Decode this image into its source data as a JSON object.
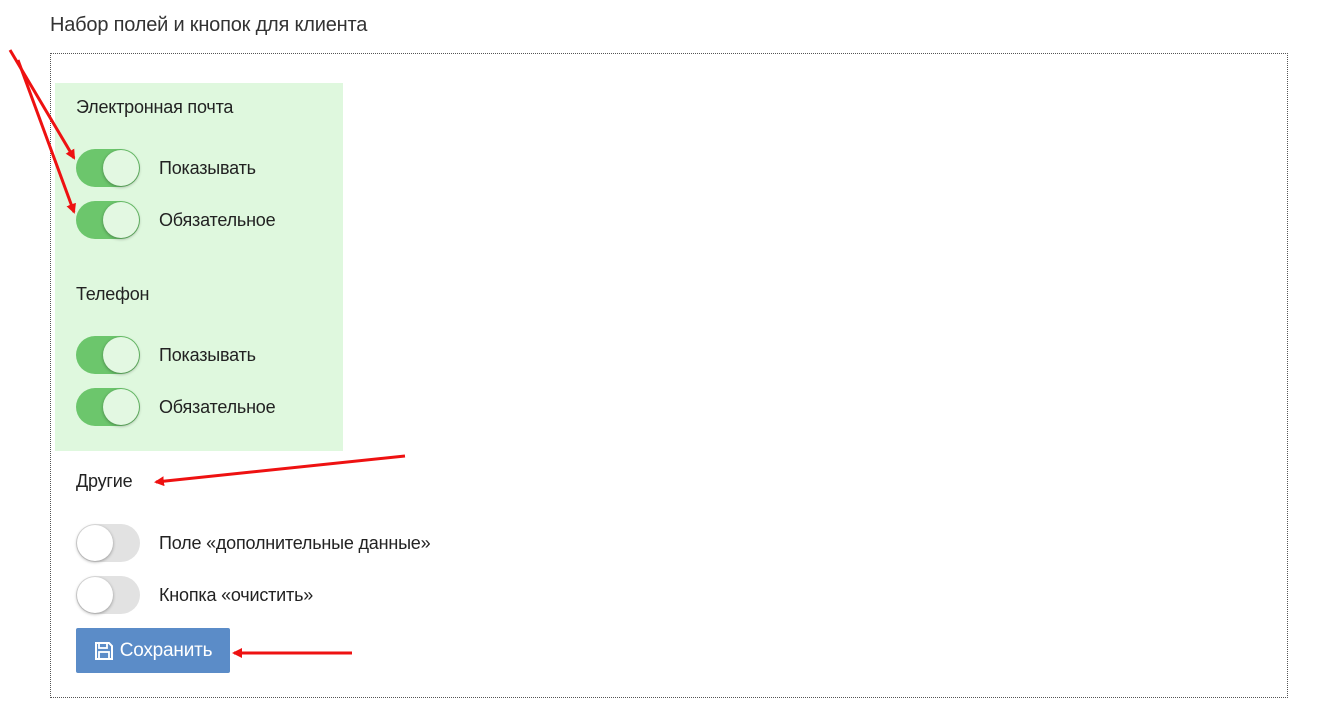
{
  "section": {
    "title": "Набор полей и кнопок для клиента"
  },
  "email_group": {
    "label": "Электронная почта",
    "show_label": "Показывать",
    "show_on": true,
    "required_label": "Обязательное",
    "required_on": true
  },
  "phone_group": {
    "label": "Телефон",
    "show_label": "Показывать",
    "show_on": true,
    "required_label": "Обязательное",
    "required_on": true
  },
  "other_group": {
    "label": "Другие",
    "extra_data_label": "Поле «дополнительные данные»",
    "extra_data_on": false,
    "clear_button_label": "Кнопка «очистить»",
    "clear_button_on": false
  },
  "save_button": {
    "label": "Сохранить",
    "icon": "floppy-disk-icon"
  },
  "colors": {
    "toggle_on": "#6cc66c",
    "toggle_off": "#e2e2e2",
    "highlight_bg": "#dff8de",
    "button_bg": "#5b8cc8",
    "annotation_arrow": "#ee1111"
  }
}
